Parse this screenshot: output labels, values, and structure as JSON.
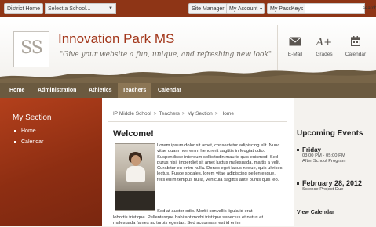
{
  "topbar": {
    "district_home": "District Home",
    "school_select": "Select a School...",
    "site_manager": "Site Manager",
    "my_account": "My Account",
    "my_passkeys": "My PassKeys",
    "search_label": "search"
  },
  "header": {
    "logo_initials": "SS",
    "school_name": "Innovation Park MS",
    "tagline": "\"Give your website a fun, unique, and refreshing new look\"",
    "quick_links": [
      {
        "label": "E-Mail",
        "icon": "mail-icon"
      },
      {
        "label": "Grades",
        "icon": "grades-icon",
        "glyph": "A+"
      },
      {
        "label": "Calendar",
        "icon": "calendar-icon"
      }
    ]
  },
  "nav": {
    "items": [
      "Home",
      "Administration",
      "Athletics",
      "Teachers",
      "Calendar"
    ],
    "active": "Teachers"
  },
  "sidebar": {
    "title": "My Section",
    "items": [
      "Home",
      "Calendar"
    ]
  },
  "main": {
    "breadcrumb": [
      "IP Middle School",
      "Teachers",
      "My Section",
      "Home"
    ],
    "heading": "Welcome!",
    "para1": "Lorem ipsum dolor sit amet, consectetur adipiscing elit. Nunc vitae quam non enim hendrerit sagittis in feugiat odio. Suspendisse interdum sollicitudin mauris quis euismod. Sed purus nisi, imperdiet sit amet luctus malesuada, mattis a velit. Curabitur eu enim nulla. Donec eget lacus neque, quis ultrices lectus. Fusce sodales, lorem vitae adipiscing pellentesque, felis enim tempus nulla, vehicula sagittis ante purus quis leo.",
    "para2_start": "Sed at auctor odio. Morbi convallis ligula id erat",
    "para2_rest": "lobortis tristique. Pellentesque habitant morbi tristique senectus et netus et malesuada fames ac turpis egestas. Sed accumsan est id enim"
  },
  "events": {
    "title": "Upcoming Events",
    "items": [
      {
        "heading": "Friday",
        "time": "03:00 PM - 05:00 PM",
        "name": "After School Program"
      },
      {
        "heading": "February 28, 2012",
        "time": "",
        "name": "Science Project Due"
      }
    ],
    "view_calendar": "View Calendar"
  },
  "colors": {
    "topbar": "#8e3516",
    "accent": "#a2361a",
    "nav": "#6b5a40",
    "sidebar": "#a83a1a"
  }
}
